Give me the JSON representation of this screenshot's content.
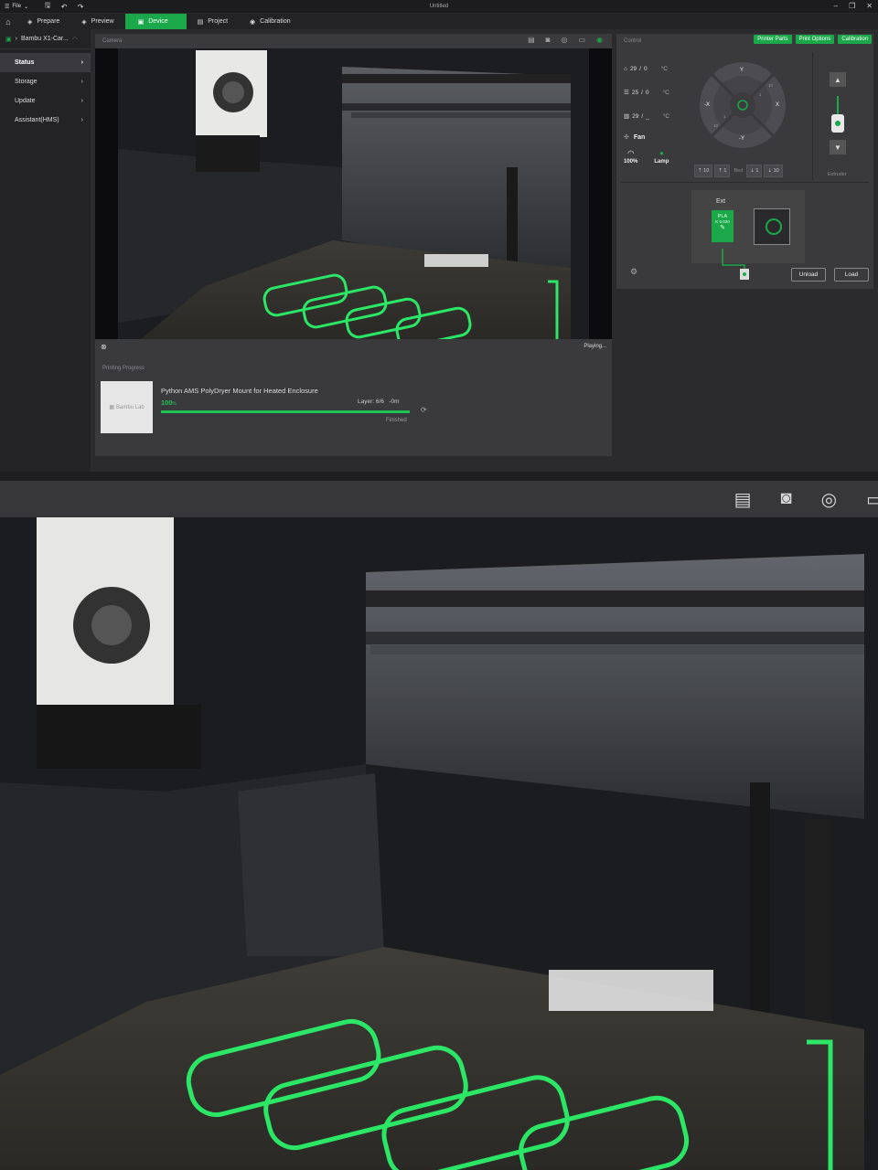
{
  "window": {
    "title": "Untitled",
    "file_menu": "File"
  },
  "tabs": [
    {
      "label": "Prepare",
      "active": false
    },
    {
      "label": "Preview",
      "active": false
    },
    {
      "label": "Device",
      "active": true
    },
    {
      "label": "Project",
      "active": false
    },
    {
      "label": "Calibration",
      "active": false
    }
  ],
  "sidebar": {
    "printer": "Bambu X1-Car...",
    "items": [
      {
        "label": "Status",
        "active": true
      },
      {
        "label": "Storage",
        "active": false
      },
      {
        "label": "Update",
        "active": false
      },
      {
        "label": "Assistant(HMS)",
        "active": false
      }
    ]
  },
  "camera": {
    "title": "Camera",
    "status": "Playing..."
  },
  "progress": {
    "title": "Printing Progress",
    "thumb_text": "Bambu Lab",
    "name": "Python AMS PolyDryer Mount for Heated Enclosure",
    "percent": "100",
    "percent_unit": "%",
    "progress_fraction": 1.0,
    "layer": "Layer: 6/6",
    "remaining": "-0m",
    "status": "Finished"
  },
  "control": {
    "title": "Control",
    "buttons": {
      "parts": "Printer Parts",
      "options": "Print Options",
      "calibration": "Calibration"
    },
    "temps": [
      {
        "current": "29",
        "target": "0",
        "unit": "°C"
      },
      {
        "current": "25",
        "target": "0",
        "unit": "°C"
      },
      {
        "current": "29",
        "target": "_",
        "unit": "°C"
      }
    ],
    "fan": "Fan",
    "speed": "100%",
    "lamp": "Lamp",
    "axes": {
      "y_top": "Y",
      "y_bottom": "-Y",
      "x_left": "-X",
      "x_right": "X",
      "r10": "10",
      "r1": "1",
      "l10": "10",
      "l1": "1"
    },
    "jog": {
      "up10": "10",
      "up1": "1",
      "bed": "Bed",
      "down1": "1",
      "down10": "10"
    },
    "extruder_label": "Extruder"
  },
  "ams": {
    "ext_title": "Ext",
    "filament_type": "PLA",
    "filament_code": "K 0.020",
    "unload": "Unload",
    "load": "Load"
  },
  "colors": {
    "accent": "#1aa84a",
    "glow": "#2cf06a"
  }
}
